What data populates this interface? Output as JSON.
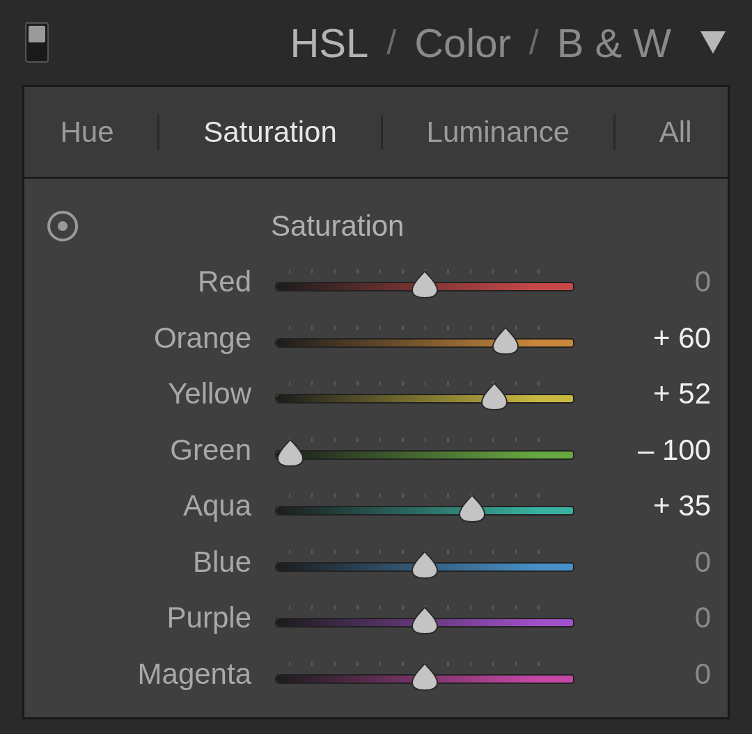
{
  "panel_enabled": true,
  "header": {
    "modes": [
      {
        "label": "HSL",
        "selected": true
      },
      {
        "label": "Color",
        "selected": false
      },
      {
        "label": "B & W",
        "selected": false
      }
    ],
    "separator": "/"
  },
  "tabs": [
    {
      "label": "Hue",
      "selected": false
    },
    {
      "label": "Saturation",
      "selected": true
    },
    {
      "label": "Luminance",
      "selected": false
    },
    {
      "label": "All",
      "selected": false
    }
  ],
  "section_title": "Saturation",
  "sliders": [
    {
      "name": "Red",
      "color": "#c84848",
      "level": 0.5,
      "reading": "0"
    },
    {
      "name": "Orange",
      "color": "#c8883c",
      "level": 0.8,
      "reading": "+ 60"
    },
    {
      "name": "Yellow",
      "color": "#c8b840",
      "level": 0.76,
      "reading": "+ 52"
    },
    {
      "name": "Green",
      "color": "#68a840",
      "level": 0,
      "reading": "– 100"
    },
    {
      "name": "Aqua",
      "color": "#38b0a0",
      "level": 0.675,
      "reading": "+ 35"
    },
    {
      "name": "Blue",
      "color": "#4890c8",
      "level": 0.5,
      "reading": "0"
    },
    {
      "name": "Purple",
      "color": "#a050c8",
      "level": 0.5,
      "reading": "0"
    },
    {
      "name": "Magenta",
      "color": "#c848a8",
      "level": 0.5,
      "reading": "0"
    }
  ]
}
